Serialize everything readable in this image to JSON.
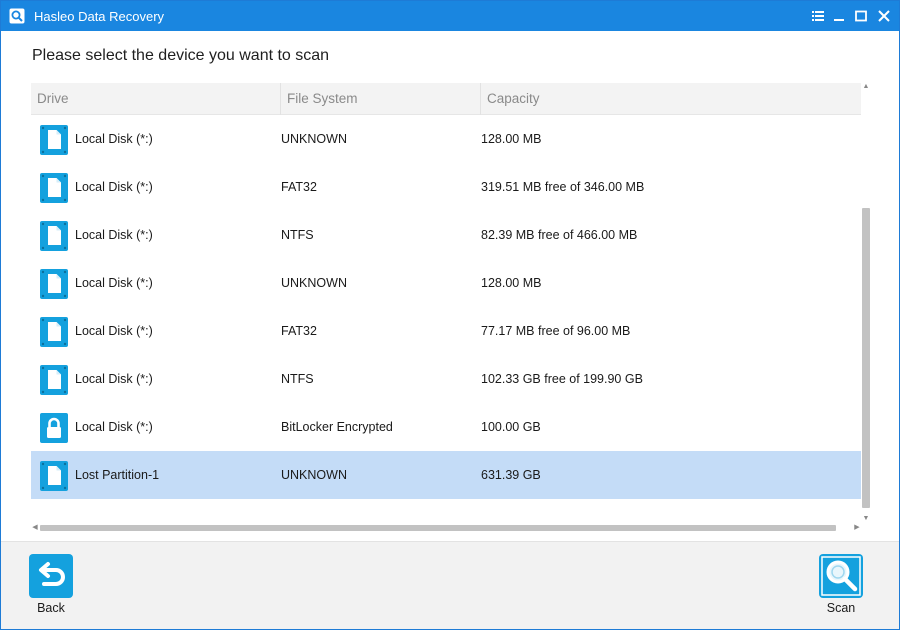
{
  "window": {
    "title": "Hasleo Data Recovery"
  },
  "titlebar_buttons": [
    {
      "name": "menu-icon"
    },
    {
      "name": "minimize-icon"
    },
    {
      "name": "maximize-icon"
    },
    {
      "name": "close-icon"
    }
  ],
  "prompt": "Please select the device you want to scan",
  "table": {
    "columns": [
      "Drive",
      "File System",
      "Capacity"
    ],
    "rows": [
      {
        "icon": "drive-icon",
        "drive": "Local Disk (*:)",
        "fs": "UNKNOWN",
        "capacity": "128.00 MB",
        "selected": false
      },
      {
        "icon": "drive-icon",
        "drive": "Local Disk (*:)",
        "fs": "FAT32",
        "capacity": "319.51 MB free of 346.00 MB",
        "selected": false
      },
      {
        "icon": "drive-icon",
        "drive": "Local Disk (*:)",
        "fs": "NTFS",
        "capacity": "82.39 MB free of 466.00 MB",
        "selected": false
      },
      {
        "icon": "drive-icon",
        "drive": "Local Disk (*:)",
        "fs": "UNKNOWN",
        "capacity": "128.00 MB",
        "selected": false
      },
      {
        "icon": "drive-icon",
        "drive": "Local Disk (*:)",
        "fs": "FAT32",
        "capacity": "77.17 MB free of 96.00 MB",
        "selected": false
      },
      {
        "icon": "drive-icon",
        "drive": "Local Disk (*:)",
        "fs": "NTFS",
        "capacity": "102.33 GB free of 199.90 GB",
        "selected": false
      },
      {
        "icon": "lock-icon",
        "drive": "Local Disk (*:)",
        "fs": "BitLocker Encrypted",
        "capacity": "100.00 GB",
        "selected": false
      },
      {
        "icon": "drive-icon",
        "drive": "Lost Partition-1",
        "fs": "UNKNOWN",
        "capacity": "631.39 GB",
        "selected": true
      }
    ]
  },
  "footer": {
    "back_label": "Back",
    "scan_label": "Scan"
  },
  "colors": {
    "titlebar": "#1a86e0",
    "accent": "#14a1de",
    "selected_row": "#c4dcf7"
  }
}
